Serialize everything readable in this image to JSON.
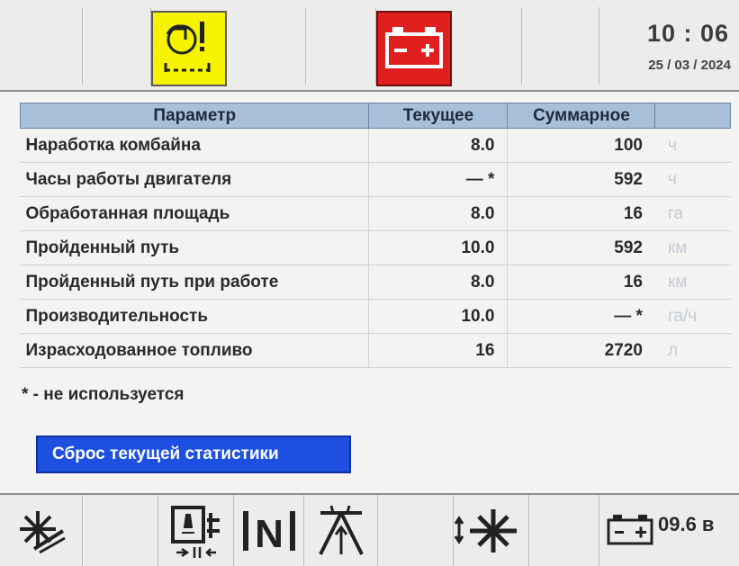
{
  "header": {
    "time": "10 : 06",
    "date": "25 / 03 / 2024",
    "warning_icon": "engine-warning-icon",
    "battery_icon": "battery-alert-icon"
  },
  "table": {
    "headers": [
      "Параметр",
      "Текущее",
      "Суммарное",
      ""
    ],
    "rows": [
      {
        "name": "Наработка комбайна",
        "current": "8.0",
        "total": "100",
        "unit": "ч"
      },
      {
        "name": "Часы работы двигателя",
        "current": "— *",
        "total": "592",
        "unit": "ч"
      },
      {
        "name": "Обработанная площадь",
        "current": "8.0",
        "total": "16",
        "unit": "га"
      },
      {
        "name": "Пройденный путь",
        "current": "10.0",
        "total": "592",
        "unit": "км"
      },
      {
        "name": "Пройденный путь при работе",
        "current": "8.0",
        "total": "16",
        "unit": "км"
      },
      {
        "name": "Производительность",
        "current": "10.0",
        "total": "— *",
        "unit": "га/ч"
      },
      {
        "name": "Израсходованное топливо",
        "current": "16",
        "total": "2720",
        "unit": "л"
      }
    ]
  },
  "footnote": "* - не используется",
  "reset_button": "Сброс текущей статистики",
  "footer": {
    "voltage": "09.6 в"
  },
  "colors": {
    "header_bg": "#a7bfd8",
    "warning_yellow": "#f6f200",
    "alert_red": "#e21f1f",
    "button_blue": "#1d4fe0"
  }
}
